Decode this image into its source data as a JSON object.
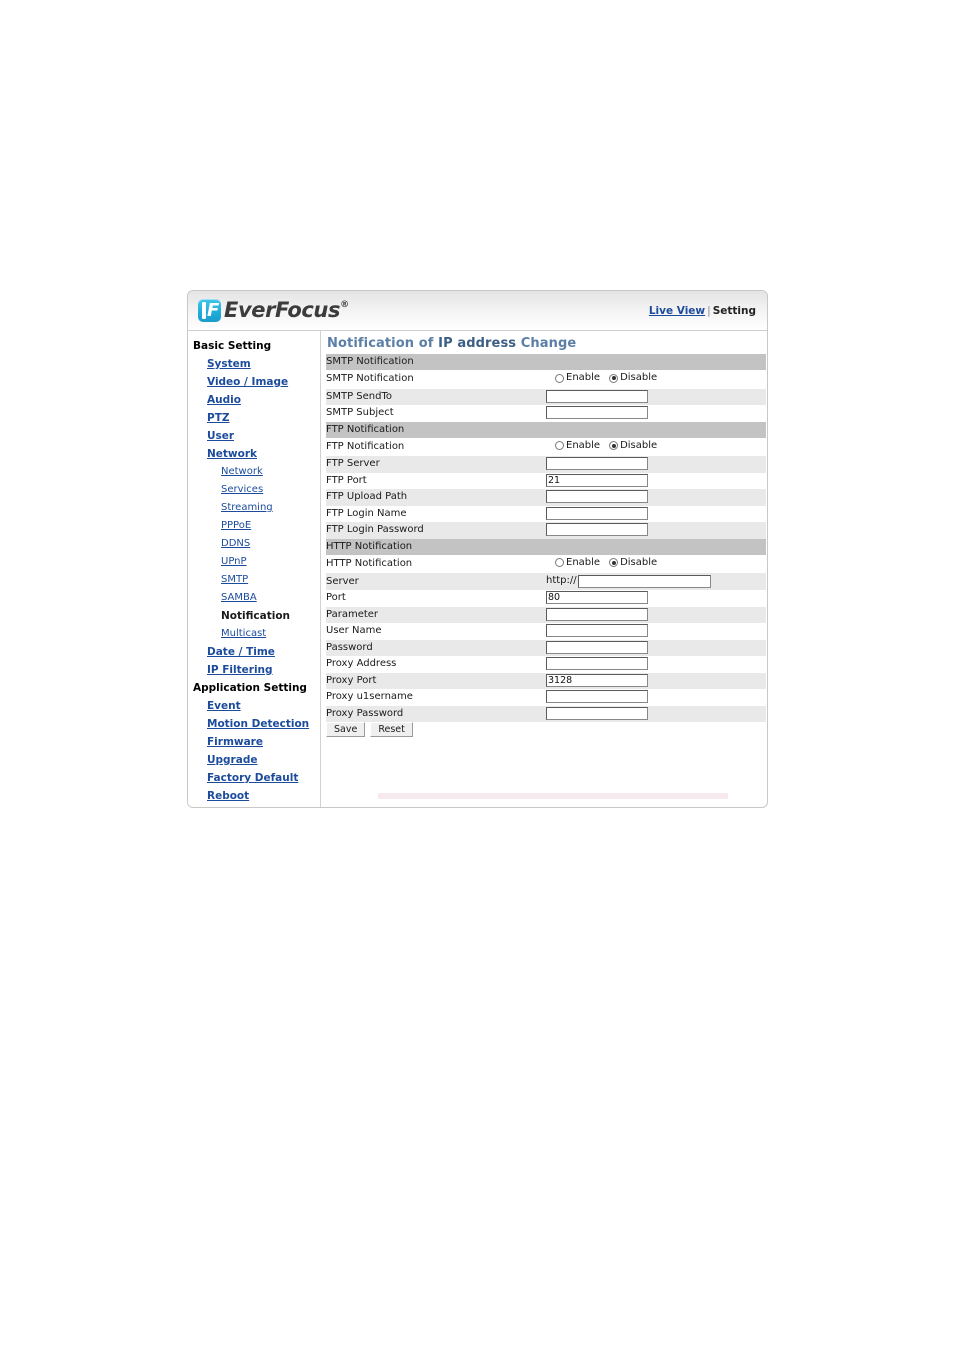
{
  "header": {
    "logo_text": "EverFocus",
    "logo_reg": "®",
    "live_view_label": "Live View",
    "separator": "|",
    "setting_label": "Setting"
  },
  "sidebar": {
    "items": [
      {
        "label": "Basic Setting",
        "level": "group",
        "state": "heading"
      },
      {
        "label": "System",
        "level": "lvl1",
        "state": "link"
      },
      {
        "label": "Video / Image",
        "level": "lvl1",
        "state": "link"
      },
      {
        "label": "Audio",
        "level": "lvl1",
        "state": "link"
      },
      {
        "label": "PTZ",
        "level": "lvl1",
        "state": "link"
      },
      {
        "label": "User",
        "level": "lvl1",
        "state": "link"
      },
      {
        "label": "Network",
        "level": "lvl1",
        "state": "link"
      },
      {
        "label": "Network",
        "level": "lvl2",
        "state": "link"
      },
      {
        "label": "Services",
        "level": "lvl2",
        "state": "link"
      },
      {
        "label": "Streaming",
        "level": "lvl2",
        "state": "link"
      },
      {
        "label": "PPPoE",
        "level": "lvl2",
        "state": "link"
      },
      {
        "label": "DDNS",
        "level": "lvl2",
        "state": "link"
      },
      {
        "label": "UPnP",
        "level": "lvl2",
        "state": "link"
      },
      {
        "label": "SMTP",
        "level": "lvl2",
        "state": "link"
      },
      {
        "label": "SAMBA",
        "level": "lvl2",
        "state": "link"
      },
      {
        "label": "Notification",
        "level": "lvl2",
        "state": "active"
      },
      {
        "label": "Multicast",
        "level": "lvl2",
        "state": "link"
      },
      {
        "label": "Date / Time",
        "level": "lvl1",
        "state": "link"
      },
      {
        "label": "IP Filtering",
        "level": "lvl1",
        "state": "link"
      },
      {
        "label": "Application Setting",
        "level": "group",
        "state": "heading"
      },
      {
        "label": "Event",
        "level": "lvl1",
        "state": "link"
      },
      {
        "label": "Motion Detection",
        "level": "lvl1",
        "state": "link"
      },
      {
        "label": "Firmware",
        "level": "lvl1",
        "state": "link"
      },
      {
        "label": "Upgrade",
        "level": "lvl1",
        "state": "link"
      },
      {
        "label": "Factory Default",
        "level": "lvl1",
        "state": "link"
      },
      {
        "label": "Reboot",
        "level": "lvl1",
        "state": "link"
      }
    ]
  },
  "main": {
    "title_part1": "Notification of ",
    "title_part2": "IP address",
    "title_part3": " Change",
    "radio_enable_label": "Enable",
    "radio_disable_label": "Disable",
    "http_prefix": "http://",
    "save_label": "Save",
    "reset_label": "Reset",
    "rows": [
      {
        "kind": "section",
        "label": "SMTP Notification"
      },
      {
        "kind": "radio",
        "label": "SMTP Notification",
        "selected": "Disable"
      },
      {
        "kind": "input",
        "label": "SMTP SendTo",
        "value": ""
      },
      {
        "kind": "input",
        "label": "SMTP Subject",
        "value": ""
      },
      {
        "kind": "section",
        "label": "FTP Notification"
      },
      {
        "kind": "radio",
        "label": "FTP Notification",
        "selected": "Disable"
      },
      {
        "kind": "input",
        "label": "FTP Server",
        "value": ""
      },
      {
        "kind": "input",
        "label": "FTP Port",
        "value": "21"
      },
      {
        "kind": "input",
        "label": "FTP Upload Path",
        "value": ""
      },
      {
        "kind": "input",
        "label": "FTP Login Name",
        "value": ""
      },
      {
        "kind": "input",
        "label": "FTP Login Password",
        "value": ""
      },
      {
        "kind": "section",
        "label": "HTTP Notification"
      },
      {
        "kind": "radio",
        "label": "HTTP Notification",
        "selected": "Disable"
      },
      {
        "kind": "prefixed-input",
        "label": "Server",
        "value": ""
      },
      {
        "kind": "input",
        "label": "Port",
        "value": "80"
      },
      {
        "kind": "input",
        "label": "Parameter",
        "value": ""
      },
      {
        "kind": "input",
        "label": "User Name",
        "value": ""
      },
      {
        "kind": "input",
        "label": "Password",
        "value": ""
      },
      {
        "kind": "input",
        "label": "Proxy Address",
        "value": ""
      },
      {
        "kind": "input",
        "label": "Proxy Port",
        "value": "3128"
      },
      {
        "kind": "input",
        "label": "Proxy u1sername",
        "value": ""
      },
      {
        "kind": "input",
        "label": "Proxy Password",
        "value": ""
      }
    ]
  },
  "colors": {
    "title": "#5b7fa6",
    "link": "#1c4b9c",
    "section_bg": "#c3c3c3",
    "row_alt_bg": "#e9e9e9",
    "logo_cyan": "#21aedb"
  }
}
